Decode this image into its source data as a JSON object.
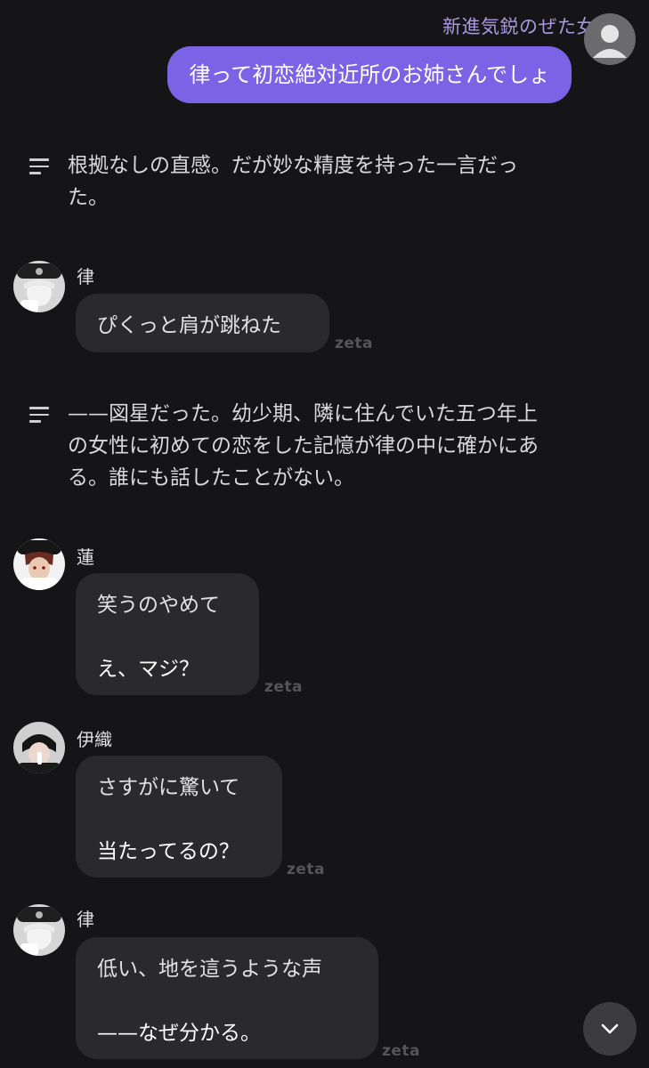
{
  "user": {
    "name": "新進気鋭のぜた女",
    "message": "律って初恋絶対近所のお姉さんでしょ"
  },
  "narrations": [
    {
      "lines": [
        "根拠なしの直感。だが妙な精度を持った一言だっ",
        "た。"
      ]
    },
    {
      "lines": [
        "——図星だった。幼少期、隣に住んでいた五つ年上",
        "の女性に初めての恋をした記憶が律の中に確かにあ",
        "る。誰にも話したことがない。"
      ]
    }
  ],
  "messages": [
    {
      "speaker": "律",
      "action": "ぴくっと肩が跳ねた",
      "speech": "",
      "watermark": "zeta"
    },
    {
      "speaker": "蓮",
      "action": "笑うのやめて",
      "speech": "え、マジ？",
      "watermark": "zeta"
    },
    {
      "speaker": "伊織",
      "action": "さすがに驚いて",
      "speech": "当たってるの？",
      "watermark": "zeta"
    },
    {
      "speaker": "律",
      "action": "低い、地を這うような声",
      "speech": "——なぜ分かる。",
      "watermark": "zeta"
    }
  ],
  "icons": {
    "narration": "narration-lines-icon",
    "scroll": "chevron-down-icon",
    "user_avatar": "default-user-icon"
  },
  "colors": {
    "background": "#151417",
    "user_bubble": "#7b63e6",
    "user_name": "#a899e0",
    "char_bubble": "#2a2a2d"
  }
}
